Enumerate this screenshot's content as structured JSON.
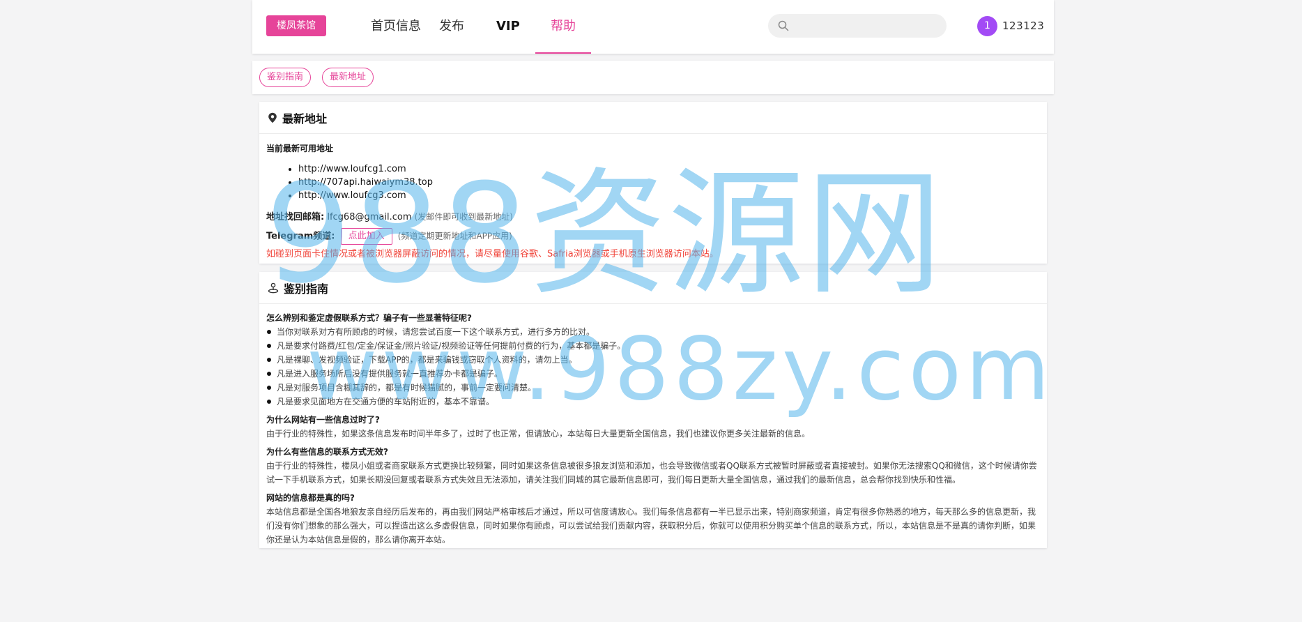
{
  "header": {
    "logo": "楼凤茶馆",
    "nav": [
      {
        "label": "首页信息"
      },
      {
        "label": "发布"
      },
      {
        "label": "VIP"
      },
      {
        "label": "帮助"
      }
    ],
    "search_placeholder": "",
    "avatar_badge": "1",
    "username": "123123"
  },
  "tags": [
    {
      "label": "鉴别指南"
    },
    {
      "label": "最新地址"
    }
  ],
  "latest": {
    "title": "最新地址",
    "subtitle": "当前最新可用地址",
    "addresses": [
      "http://www.loufcg1.com",
      "http://707api.haiwaiym38.top",
      "http://www.loufcg3.com"
    ],
    "email_label": "地址找回邮箱:",
    "email_value": "lfcg68@gmail.com",
    "email_note": "(发邮件即可收到最新地址)",
    "telegram_label": "Telegram频道:",
    "telegram_button": "点此加入",
    "telegram_note": "(频道定期更新地址和APP应用)",
    "warning": "如碰到页面卡住情况或者被浏览器屏蔽访问的情况，请尽量使用谷歌、Safria浏览器或手机原生浏览器访问本站。"
  },
  "guide": {
    "title": "鉴别指南",
    "q1": "怎么辨别和鉴定虚假联系方式？骗子有一些显著特征呢?",
    "q1_items": [
      "当你对联系对方有所顾虑的时候，请您尝试百度一下这个联系方式，进行多方的比对。",
      "凡是要求付路费/红包/定金/保证金/照片验证/视频验证等任何提前付费的行为，基本都是骗子。",
      "凡是裸聊、发视频验证，下载APP的，都是来骗钱或窃取个人资料的，请勿上当。",
      "凡是进入服务场所后没有提供服务就一直推荐办卡都是骗子。",
      "凡是对服务项目含糊其辞的，都是有时候猫腻的，事前一定要问清楚。",
      "凡是要求见面地方在交通方便的车站附近的，基本不靠谱。"
    ],
    "q2": "为什么网站有一些信息过时了?",
    "a2": "由于行业的特殊性，如果这条信息发布时间半年多了，过时了也正常，但请放心，本站每日大量更新全国信息，我们也建议你更多关注最新的信息。",
    "q3": "为什么有些信息的联系方式无效?",
    "a3": "由于行业的特殊性，楼凤小姐或者商家联系方式更换比较频繁，同时如果这条信息被很多狼友浏览和添加，也会导致微信或者QQ联系方式被暂时屏蔽或者直接被封。如果你无法搜索QQ和微信，这个时候请你尝试一下手机联系方式，如果长期没回复或者联系方式失效且无法添加，请关注我们同城的其它最新信息即可，我们每日更新大量全国信息，通过我们的最新信息，总会帮你找到快乐和性福。",
    "q4": "网站的信息都是真的吗?",
    "a4": "本站信息都是全国各地狼友亲自经历后发布的，再由我们网站严格审核后才通过，所以可信度请放心。我们每条信息都有一半已显示出来，特别商家频道，肯定有很多你熟悉的地方，每天那么多的信息更新，我们没有你们想象的那么强大，可以捏造出这么多虚假信息，同时如果你有顾虑，可以尝试给我们贡献内容，获取积分后，你就可以使用积分购买单个信息的联系方式，所以，本站信息是不是真的请你判断，如果你还是认为本站信息是假的，那么请你离开本站。"
  },
  "watermark": {
    "line1": "988资源网",
    "line2": "www.988zy.com"
  },
  "colors": {
    "accent": "#e64499",
    "avatar": "#a24bf5",
    "warning": "#f0443a",
    "watermark": "#54b4eb"
  }
}
